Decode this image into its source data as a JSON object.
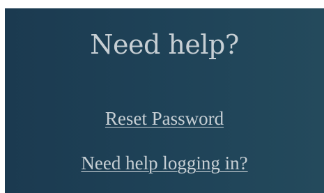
{
  "help_panel": {
    "title": "Need help?",
    "links": {
      "reset_password": "Reset Password",
      "login_help": "Need help logging in?"
    },
    "colors": {
      "panel_background": "#1f4358",
      "text": "#c7cfd4"
    }
  }
}
